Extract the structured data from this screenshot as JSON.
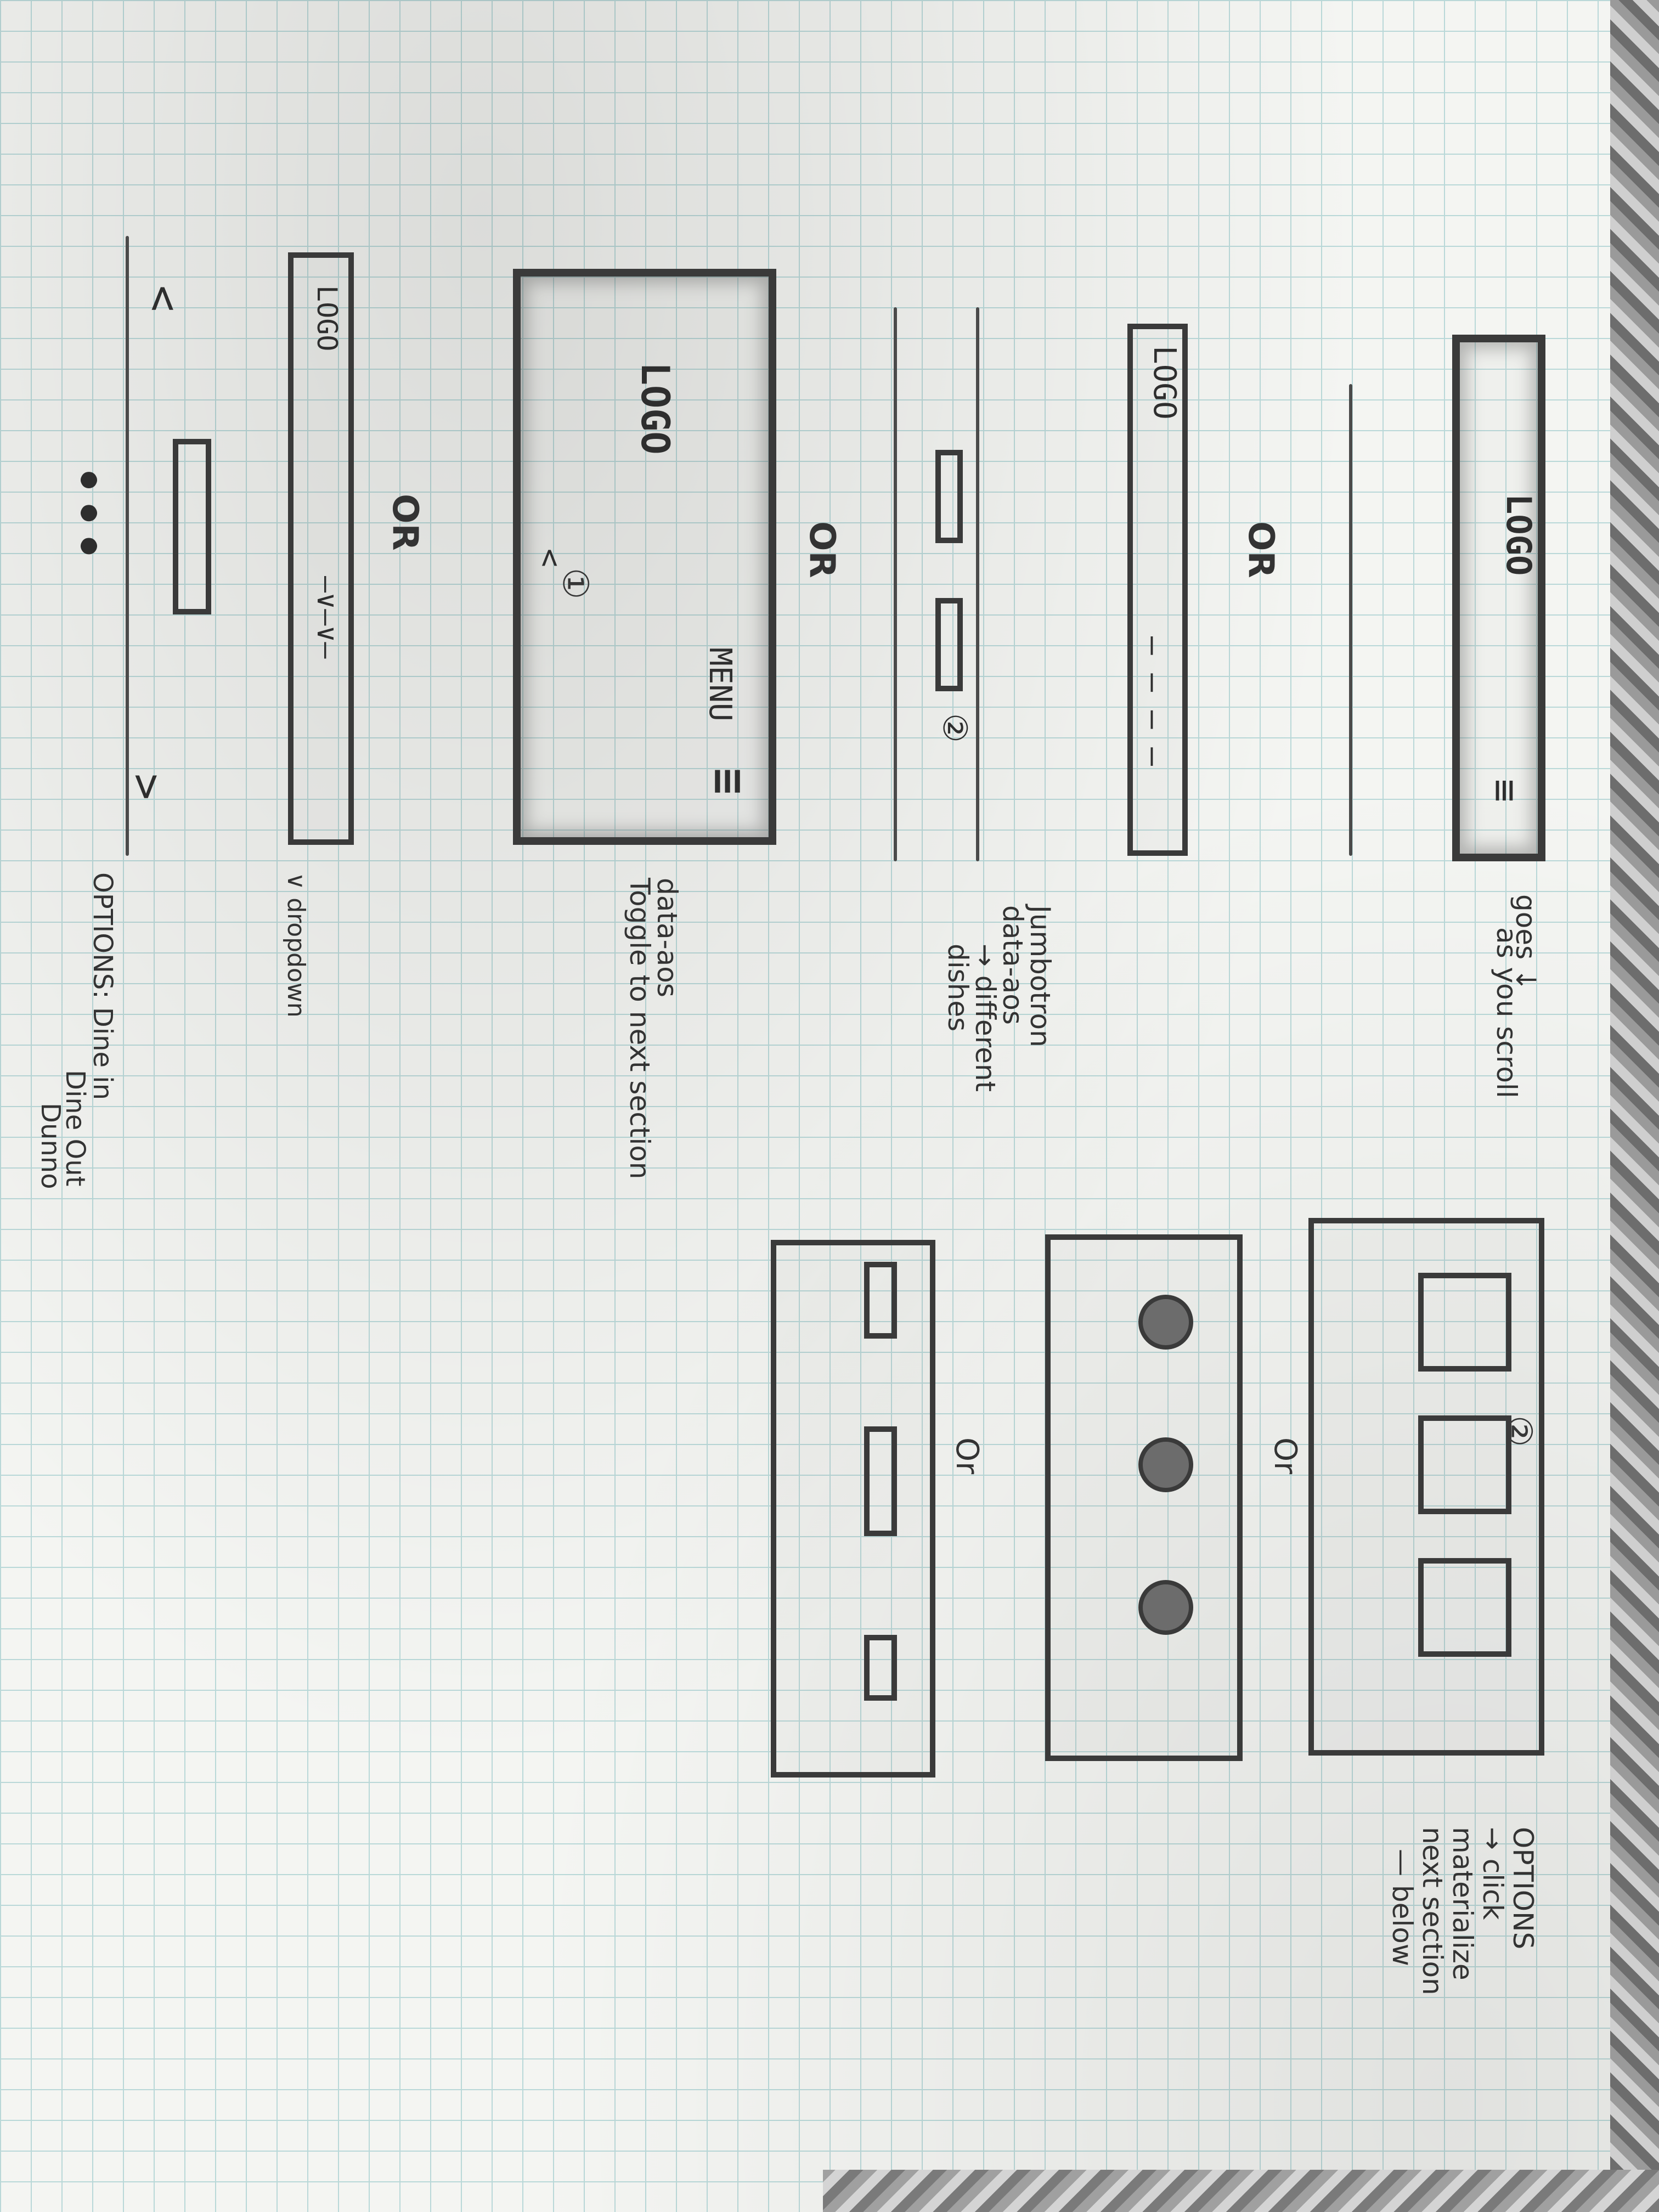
{
  "sketch": {
    "section1_number": "①",
    "section2_number": "②",
    "logo": "LOGO",
    "menu": "MENU",
    "hamburger": "≡",
    "or": "OR",
    "or_alt": "Or",
    "note_scroll_1": "goes ↓",
    "note_scroll_2": "as you scroll",
    "note_jumbotron_1": "Jumbotron",
    "note_jumbotron_2": "data-aos",
    "note_jumbotron_3": "→ different",
    "note_jumbotron_4": "dishes",
    "note_toggle_1": "data-aos",
    "note_toggle_2": "Toggle to next section",
    "note_dropdown": "∨ dropdown",
    "note_options_title": "OPTIONS: Dine in",
    "note_options_2": "Dine Out",
    "note_options_3": "Dunno",
    "note_right_1": "OPTIONS",
    "note_right_2": "→ click",
    "note_right_3": "materialize",
    "note_right_4": "next section",
    "note_right_5": "— below",
    "carousel_left": "<",
    "carousel_right": ">",
    "dots": "● ● ●",
    "nav_dashes": "— — — —",
    "nav_drop": "—∨—∨—",
    "badge_2": "②"
  }
}
